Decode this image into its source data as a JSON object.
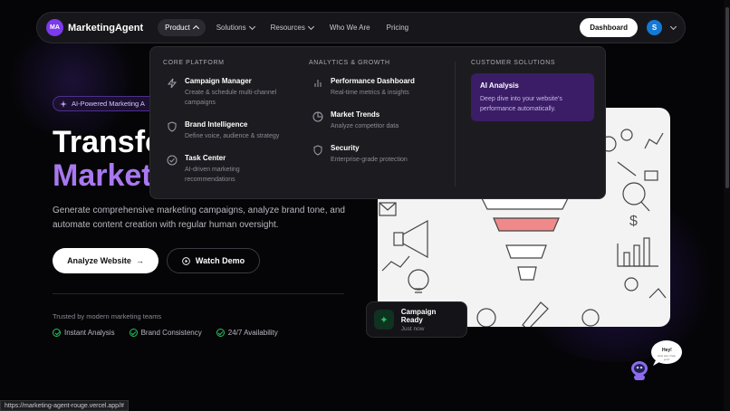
{
  "brand": {
    "badge": "MA",
    "name": "MarketingAgent"
  },
  "nav": {
    "items": [
      {
        "label": "Product",
        "has_dropdown": true,
        "active": true
      },
      {
        "label": "Solutions",
        "has_dropdown": true
      },
      {
        "label": "Resources",
        "has_dropdown": true
      },
      {
        "label": "Who We Are"
      },
      {
        "label": "Pricing"
      }
    ],
    "dashboard_label": "Dashboard",
    "avatar_initial": "S"
  },
  "dropdown": {
    "columns": [
      {
        "heading": "CORE PLATFORM",
        "items": [
          {
            "icon": "lightning-icon",
            "title": "Campaign Manager",
            "desc": "Create & schedule multi-channel campaigns"
          },
          {
            "icon": "shield-icon",
            "title": "Brand Intelligence",
            "desc": "Define voice, audience & strategy"
          },
          {
            "icon": "check-circle-icon",
            "title": "Task Center",
            "desc": "AI-driven marketing recommendations"
          }
        ]
      },
      {
        "heading": "ANALYTICS & GROWTH",
        "items": [
          {
            "icon": "bar-chart-icon",
            "title": "Performance Dashboard",
            "desc": "Real-time metrics & insights"
          },
          {
            "icon": "pie-chart-icon",
            "title": "Market Trends",
            "desc": "Analyze competitor data"
          },
          {
            "icon": "shield-icon",
            "title": "Security",
            "desc": "Enterprise-grade protection"
          }
        ]
      },
      {
        "heading": "CUSTOMER SOLUTIONS",
        "items": [
          {
            "title": "AI Analysis",
            "desc": "Deep dive into your website's performance automatically."
          }
        ]
      }
    ]
  },
  "hero": {
    "pill": "AI-Powered Marketing A",
    "title_line1": "Transfo",
    "title_line2": "Market",
    "description": "Generate comprehensive marketing campaigns, analyze brand tone, and automate content creation with regular human oversight.",
    "primary_button": "Analyze Website",
    "secondary_button": "Watch Demo",
    "trusted": "Trusted by modern marketing teams",
    "features": [
      "Instant Analysis",
      "Brand Consistency",
      "24/7 Availability"
    ]
  },
  "campaign_card": {
    "title": "Campaign Ready",
    "subtitle": "Just now"
  },
  "robot_bubble": {
    "greeting": "Hey!",
    "sub": "How can I help you?"
  },
  "status_url": "https://marketing-agent-rouge.vercel.app/#",
  "colors": {
    "accent": "#7c3aed",
    "title_gradient": "#a878f0",
    "ai_box": "#3a1d66",
    "success": "#22c55e",
    "funnel_highlight": "#f08a8a"
  }
}
